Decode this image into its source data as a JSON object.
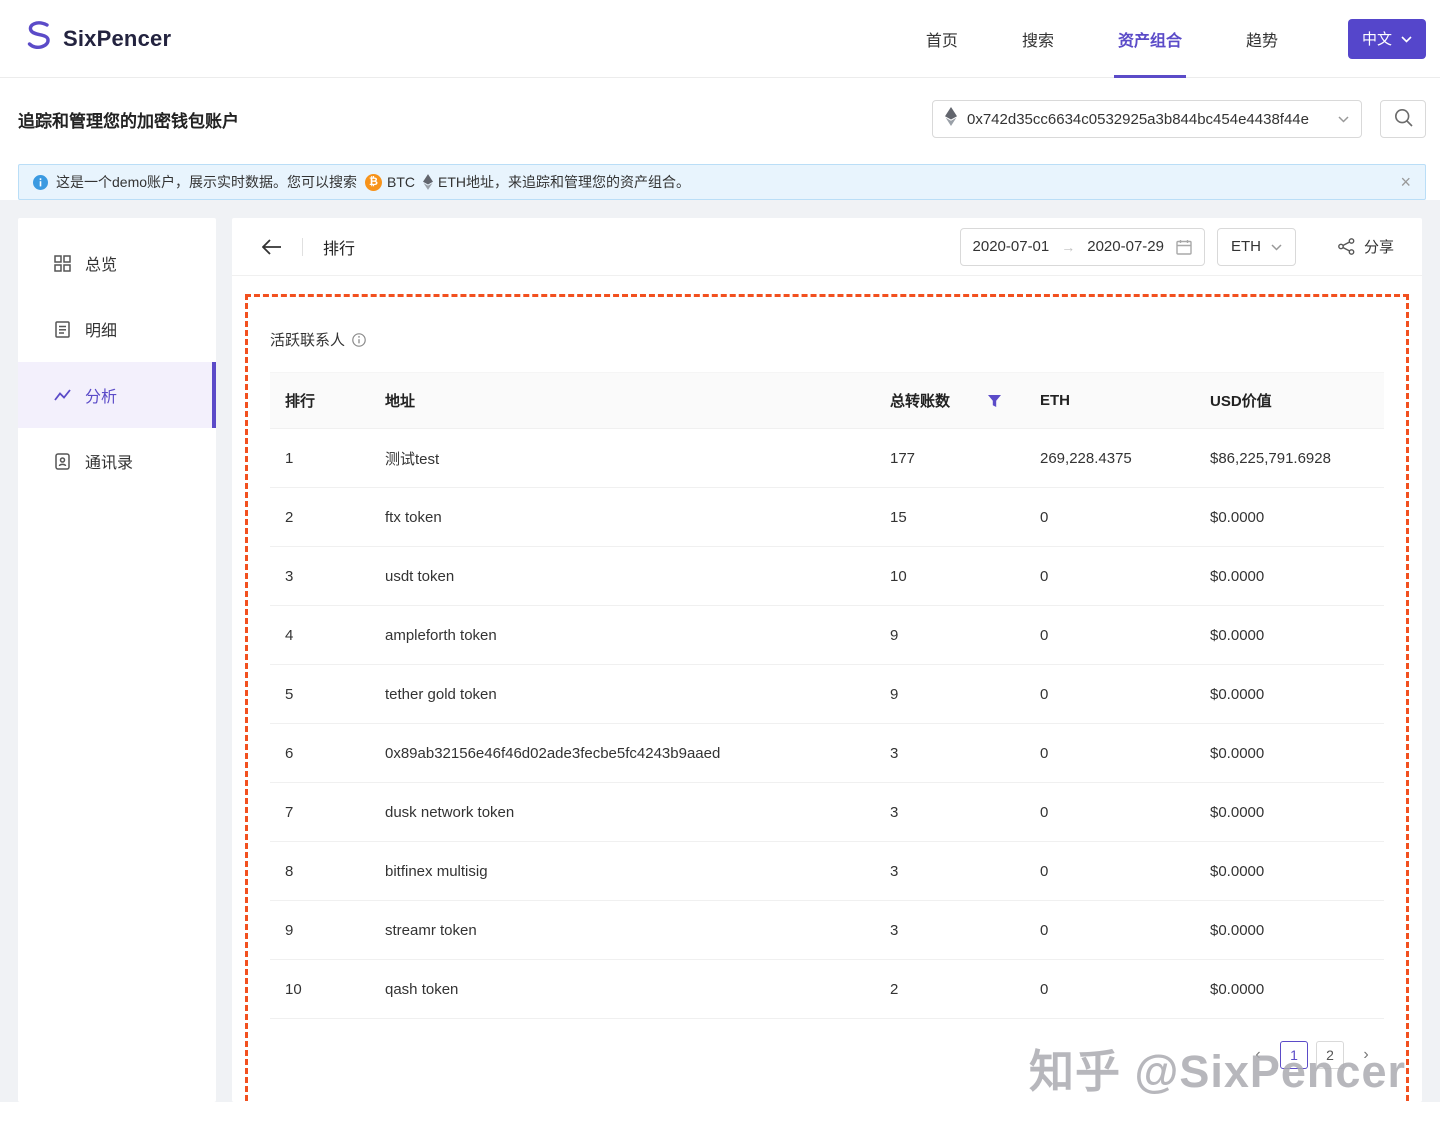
{
  "navbar": {
    "brand": "SixPencer",
    "items": [
      {
        "label": "首页",
        "active": false
      },
      {
        "label": "搜索",
        "active": false
      },
      {
        "label": "资产组合",
        "active": true
      },
      {
        "label": "趋势",
        "active": false
      }
    ],
    "lang_button": "中文"
  },
  "subheader": {
    "title": "追踪和管理您的加密钱包账户",
    "wallet_address": "0x742d35cc6634c0532925a3b844bc454e4438f44e"
  },
  "banner": {
    "text_before": "这是一个demo账户，展示实时数据。您可以搜索",
    "btc_label": "BTC",
    "eth_label": "ETH地址，来追踪和管理您的资产组合。",
    "close_label": "×"
  },
  "sidebar": {
    "items": [
      {
        "label": "总览",
        "active": false
      },
      {
        "label": "明细",
        "active": false
      },
      {
        "label": "分析",
        "active": true
      },
      {
        "label": "通讯录",
        "active": false
      }
    ]
  },
  "content": {
    "title": "排行",
    "date_from": "2020-07-01",
    "date_to": "2020-07-29",
    "currency": "ETH",
    "share_label": "分享",
    "section_title": "活跃联系人",
    "table": {
      "headers": [
        "排行",
        "地址",
        "总转账数",
        "ETH",
        "USD价值"
      ],
      "rows": [
        [
          "1",
          "测试test",
          "177",
          "269,228.4375",
          "$86,225,791.6928"
        ],
        [
          "2",
          "ftx token",
          "15",
          "0",
          "$0.0000"
        ],
        [
          "3",
          "usdt token",
          "10",
          "0",
          "$0.0000"
        ],
        [
          "4",
          "ampleforth token",
          "9",
          "0",
          "$0.0000"
        ],
        [
          "5",
          "tether gold token",
          "9",
          "0",
          "$0.0000"
        ],
        [
          "6",
          "0x89ab32156e46f46d02ade3fecbe5fc4243b9aaed",
          "3",
          "0",
          "$0.0000"
        ],
        [
          "7",
          "dusk network token",
          "3",
          "0",
          "$0.0000"
        ],
        [
          "8",
          "bitfinex multisig",
          "3",
          "0",
          "$0.0000"
        ],
        [
          "9",
          "streamr token",
          "3",
          "0",
          "$0.0000"
        ],
        [
          "10",
          "qash token",
          "2",
          "0",
          "$0.0000"
        ]
      ]
    },
    "pagination": {
      "prev": "‹",
      "pages": [
        "1",
        "2"
      ],
      "current": "1",
      "next": "›"
    }
  },
  "watermark": "知乎 @SixPencer",
  "colors": {
    "accent": "#5b4bc8",
    "dash_border": "#f2501f",
    "banner_bg": "#e8f4fd",
    "btc": "#f7931a"
  }
}
